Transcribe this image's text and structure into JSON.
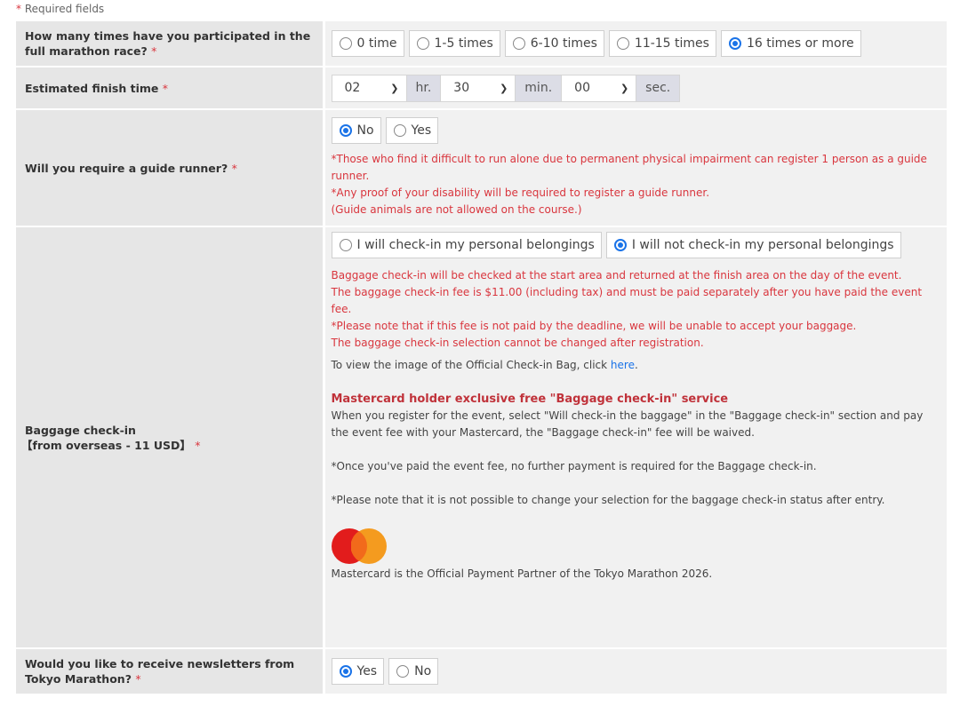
{
  "required_note": {
    "asterisk": "*",
    "text": " Required fields"
  },
  "rows": {
    "participation": {
      "label": "How many times have you participated in the full marathon race?",
      "options": [
        "0 time",
        "1-5 times",
        "6-10 times",
        "11-15 times",
        "16 times or more"
      ],
      "selected": "16 times or more"
    },
    "finish_time": {
      "label": "Estimated finish time",
      "hours": "02",
      "hours_unit": "hr.",
      "minutes": "30",
      "minutes_unit": "min.",
      "seconds": "00",
      "seconds_unit": "sec."
    },
    "guide_runner": {
      "label": "Will you require a guide runner?",
      "options": [
        "No",
        "Yes"
      ],
      "selected": "No",
      "notes": [
        "*Those who find it difficult to run alone due to permanent physical impairment can register 1 person as a guide runner.",
        "*Any proof of your disability will be required to register a guide runner.",
        "(Guide animals are not allowed on the course.)"
      ]
    },
    "baggage": {
      "label_line1": "Baggage check-in",
      "label_line2": "【from overseas - 11 USD】",
      "options": [
        "I will check-in my personal belongings",
        "I will not check-in my personal belongings"
      ],
      "selected": "I will not check-in my personal belongings",
      "red_notes": [
        "Baggage check-in will be checked at the start area and returned at the finish area on the day of the event.",
        "The baggage check-in fee is $11.00 (including tax) and must be paid separately after you have paid the event fee.",
        "*Please note that if this fee is not paid by the deadline, we will be unable to accept your baggage.",
        "The baggage check-in selection cannot be changed after registration."
      ],
      "bag_image_text": "To view the image of the Official Check-in Bag, click ",
      "bag_image_link": "here",
      "bag_image_end": ".",
      "mc_heading": "Mastercard holder exclusive free \"Baggage check-in\" service",
      "mc_text": "When you register for the event, select \"Will check-in the baggage\" in the \"Baggage check-in\" section and pay the event fee with your Mastercard, the \"Baggage check-in\" fee will be waived.",
      "mc_note1": "*Once you've paid the event fee, no further payment is required for the Baggage check-in.",
      "mc_note2": "*Please note that it is not possible to change your selection for the baggage check-in status after entry.",
      "mc_partner": "Mastercard is the Official Payment Partner of the Tokyo Marathon 2026."
    },
    "newsletter": {
      "label": "Would you like to receive newsletters from Tokyo Marathon?",
      "options": [
        "Yes",
        "No"
      ],
      "selected": "Yes"
    }
  },
  "required_marker": "*",
  "colors": {
    "required": "#d9363e",
    "radio_selected": "#1a73e8",
    "label_bg": "#e6e6e6",
    "value_bg": "#f1f1f1",
    "link": "#1a73e8"
  }
}
